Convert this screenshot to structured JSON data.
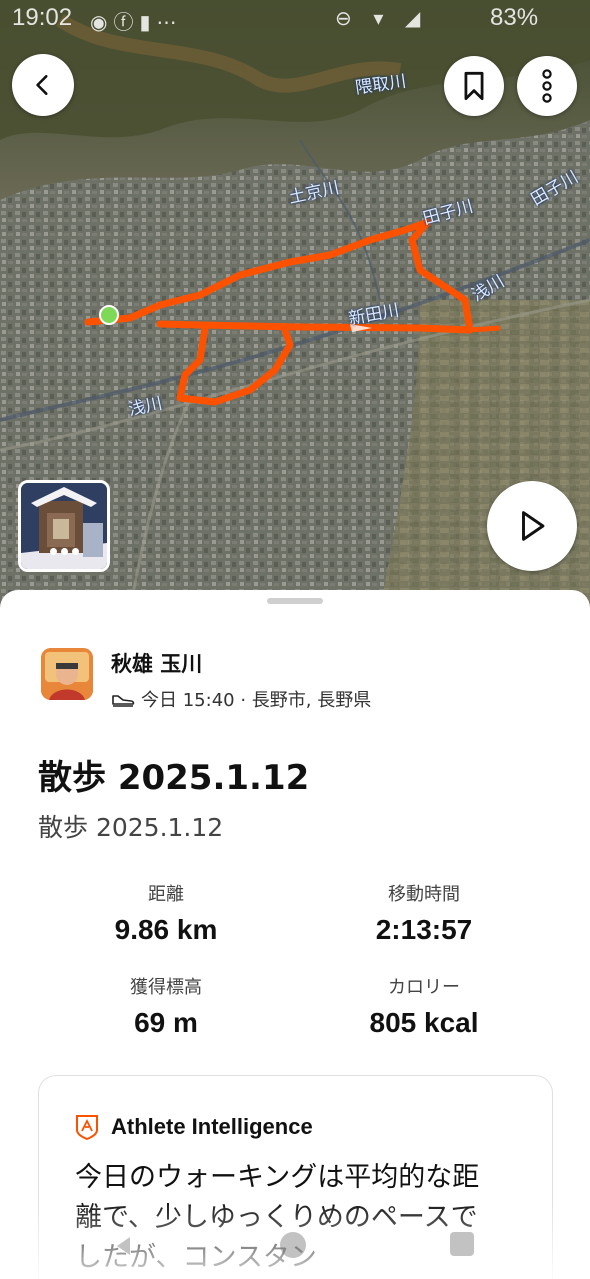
{
  "status_bar": {
    "time": "19:02",
    "notification_icons": [
      "broadcast-icon",
      "facebook-icon",
      "stack-icon",
      "more-icon"
    ],
    "system_icons": [
      "dnd-icon",
      "wifi-icon",
      "signal-icon"
    ],
    "battery": "83%"
  },
  "map": {
    "river_labels": [
      "隈取川",
      "土京川",
      "田子川",
      "田子川",
      "浅川",
      "新田川",
      "浅川"
    ],
    "colors": {
      "route": "#fc5200",
      "start_marker": "#7ed957"
    }
  },
  "toolbar": {
    "back_icon": "chevron-left-icon",
    "bookmark_icon": "bookmark-icon",
    "more_icon": "more-vertical-icon",
    "play_icon": "play-icon"
  },
  "athlete": {
    "name": "秋雄 玉川",
    "meta": "今日 15:40 · 長野市, 長野県"
  },
  "activity": {
    "title": "散歩 2025.1.12",
    "subtitle": "散歩 2025.1.12"
  },
  "stats": [
    {
      "label": "距離",
      "value": "9.86 km"
    },
    {
      "label": "移動時間",
      "value": "2:13:57"
    },
    {
      "label": "獲得標高",
      "value": "69 m"
    },
    {
      "label": "カロリー",
      "value": "805 kcal"
    }
  ],
  "ai_card": {
    "title": "Athlete Intelligence",
    "body": "今日のウォーキングは平均的な距離で、少しゆっくりめのペースでしたが、コンスタン",
    "accent": "#fc5200"
  }
}
